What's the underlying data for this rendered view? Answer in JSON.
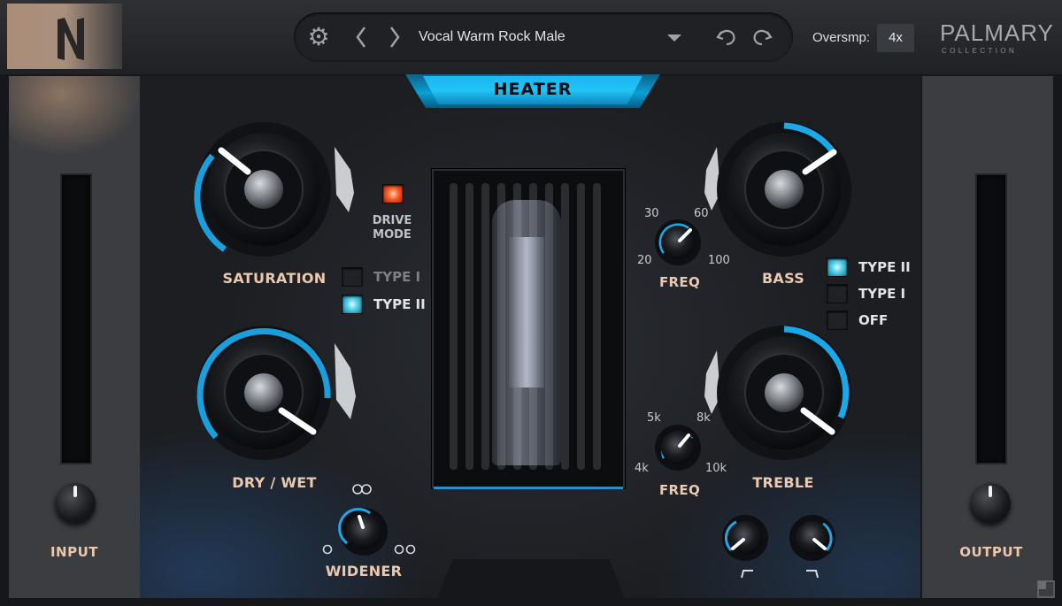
{
  "topbar": {
    "preset_name": "Vocal Warm Rock Male",
    "oversampling_label": "Oversmp:",
    "oversampling_value": "4x",
    "brand_name": "PALMARY",
    "brand_sub": "COLLECTION",
    "icons": [
      "logo-n-icon",
      "gear-icon",
      "prev-arrow-icon",
      "next-arrow-icon",
      "dropdown-arrow-icon",
      "undo-icon",
      "redo-icon"
    ]
  },
  "module_title": "HEATER",
  "io": {
    "input_label": "INPUT",
    "output_label": "OUTPUT"
  },
  "knobs": {
    "saturation": "SATURATION",
    "dry_wet": "DRY / WET",
    "widener": "WIDENER",
    "bass": "BASS",
    "treble": "TREBLE",
    "freq": "FREQ"
  },
  "drive_mode": {
    "label_line1": "DRIVE",
    "label_line2": "MODE",
    "options": [
      {
        "label": "TYPE I",
        "active": false
      },
      {
        "label": "TYPE II",
        "active": true
      }
    ]
  },
  "bass_mode": {
    "options": [
      {
        "label": "TYPE II",
        "active": true
      },
      {
        "label": "TYPE I",
        "active": false
      },
      {
        "label": "OFF",
        "active": false
      }
    ]
  },
  "bass_freq_scale": {
    "s1": "30",
    "s2": "60",
    "s3": "20",
    "s4": "100"
  },
  "treble_freq_scale": {
    "s1": "5k",
    "s2": "8k",
    "s3": "4k",
    "s4": "10k"
  },
  "colors": {
    "accent": "#1aa8e8",
    "label": "#eac9b0",
    "led_red": "#ff5a25",
    "led_blue": "#54d2ec"
  }
}
